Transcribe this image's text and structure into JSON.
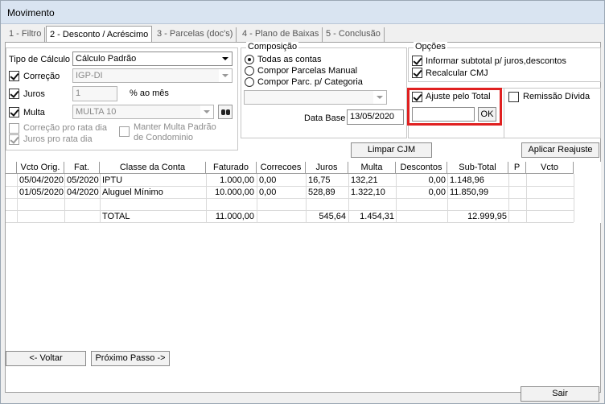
{
  "window": {
    "title": "Movimento"
  },
  "tabs": [
    {
      "label": "1 - Filtro"
    },
    {
      "label": "2 - Desconto / Acréscimo"
    },
    {
      "label": "3 - Parcelas (doc's)"
    },
    {
      "label": "4 - Plano de Baixas"
    },
    {
      "label": "5 - Conclusão"
    }
  ],
  "calc": {
    "tipo_label": "Tipo de Cálculo",
    "tipo_value": "Cálculo Padrão",
    "correcao_label": "Correção",
    "correcao_value": "IGP-DI",
    "juros_label": "Juros",
    "juros_value": "1",
    "juros_unit": "% ao mês",
    "multa_label": "Multa",
    "multa_value": "MULTA 10",
    "correcao_pro_rata": "Correção pro rata dia",
    "juros_pro_rata": "Juros pro rata dia",
    "manter_multa": "Manter Multa Padrão de Condominio"
  },
  "composicao": {
    "title": "Composição",
    "options": [
      "Todas as contas",
      "Compor Parcelas Manual",
      "Compor Parc. p/ Categoria"
    ],
    "categoria_value": "",
    "data_base_label": "Data Base",
    "data_base_value": "13/05/2020"
  },
  "opcoes": {
    "title": "Opções",
    "informar": "Informar subtotal p/ juros,descontos",
    "recalcular": "Recalcular CMJ"
  },
  "ajuste": {
    "label": "Ajuste pelo Total",
    "value": "",
    "ok_label": "OK",
    "highlight_color": "#e02020"
  },
  "remissao": {
    "label": "Remissão Dívida"
  },
  "buttons": {
    "limpar": "Limpar CJM",
    "aplicar": "Aplicar Reajuste",
    "voltar": "<- Voltar",
    "proximo": "Próximo Passo ->",
    "sair": "Sair"
  },
  "table": {
    "headers": [
      "Vcto Orig.",
      "Fat.",
      "Classe da Conta",
      "Faturado",
      "Correcoes",
      "Juros",
      "Multa",
      "Descontos",
      "Sub-Total",
      "P",
      "Vcto"
    ],
    "rows": [
      [
        "05/04/2020",
        "05/2020",
        "IPTU",
        "1.000,00",
        "0,00",
        "16,75",
        "132,21",
        "0,00",
        "1.148,96",
        "",
        ""
      ],
      [
        "01/05/2020",
        "04/2020",
        "Aluguel Mínimo",
        "10.000,00",
        "0,00",
        "528,89",
        "1.322,10",
        "0,00",
        "11.850,99",
        "",
        ""
      ]
    ],
    "total": {
      "label": "TOTAL",
      "faturado": "11.000,00",
      "juros": "545,64",
      "multa": "1.454,31",
      "subtotal": "12.999,95"
    }
  }
}
